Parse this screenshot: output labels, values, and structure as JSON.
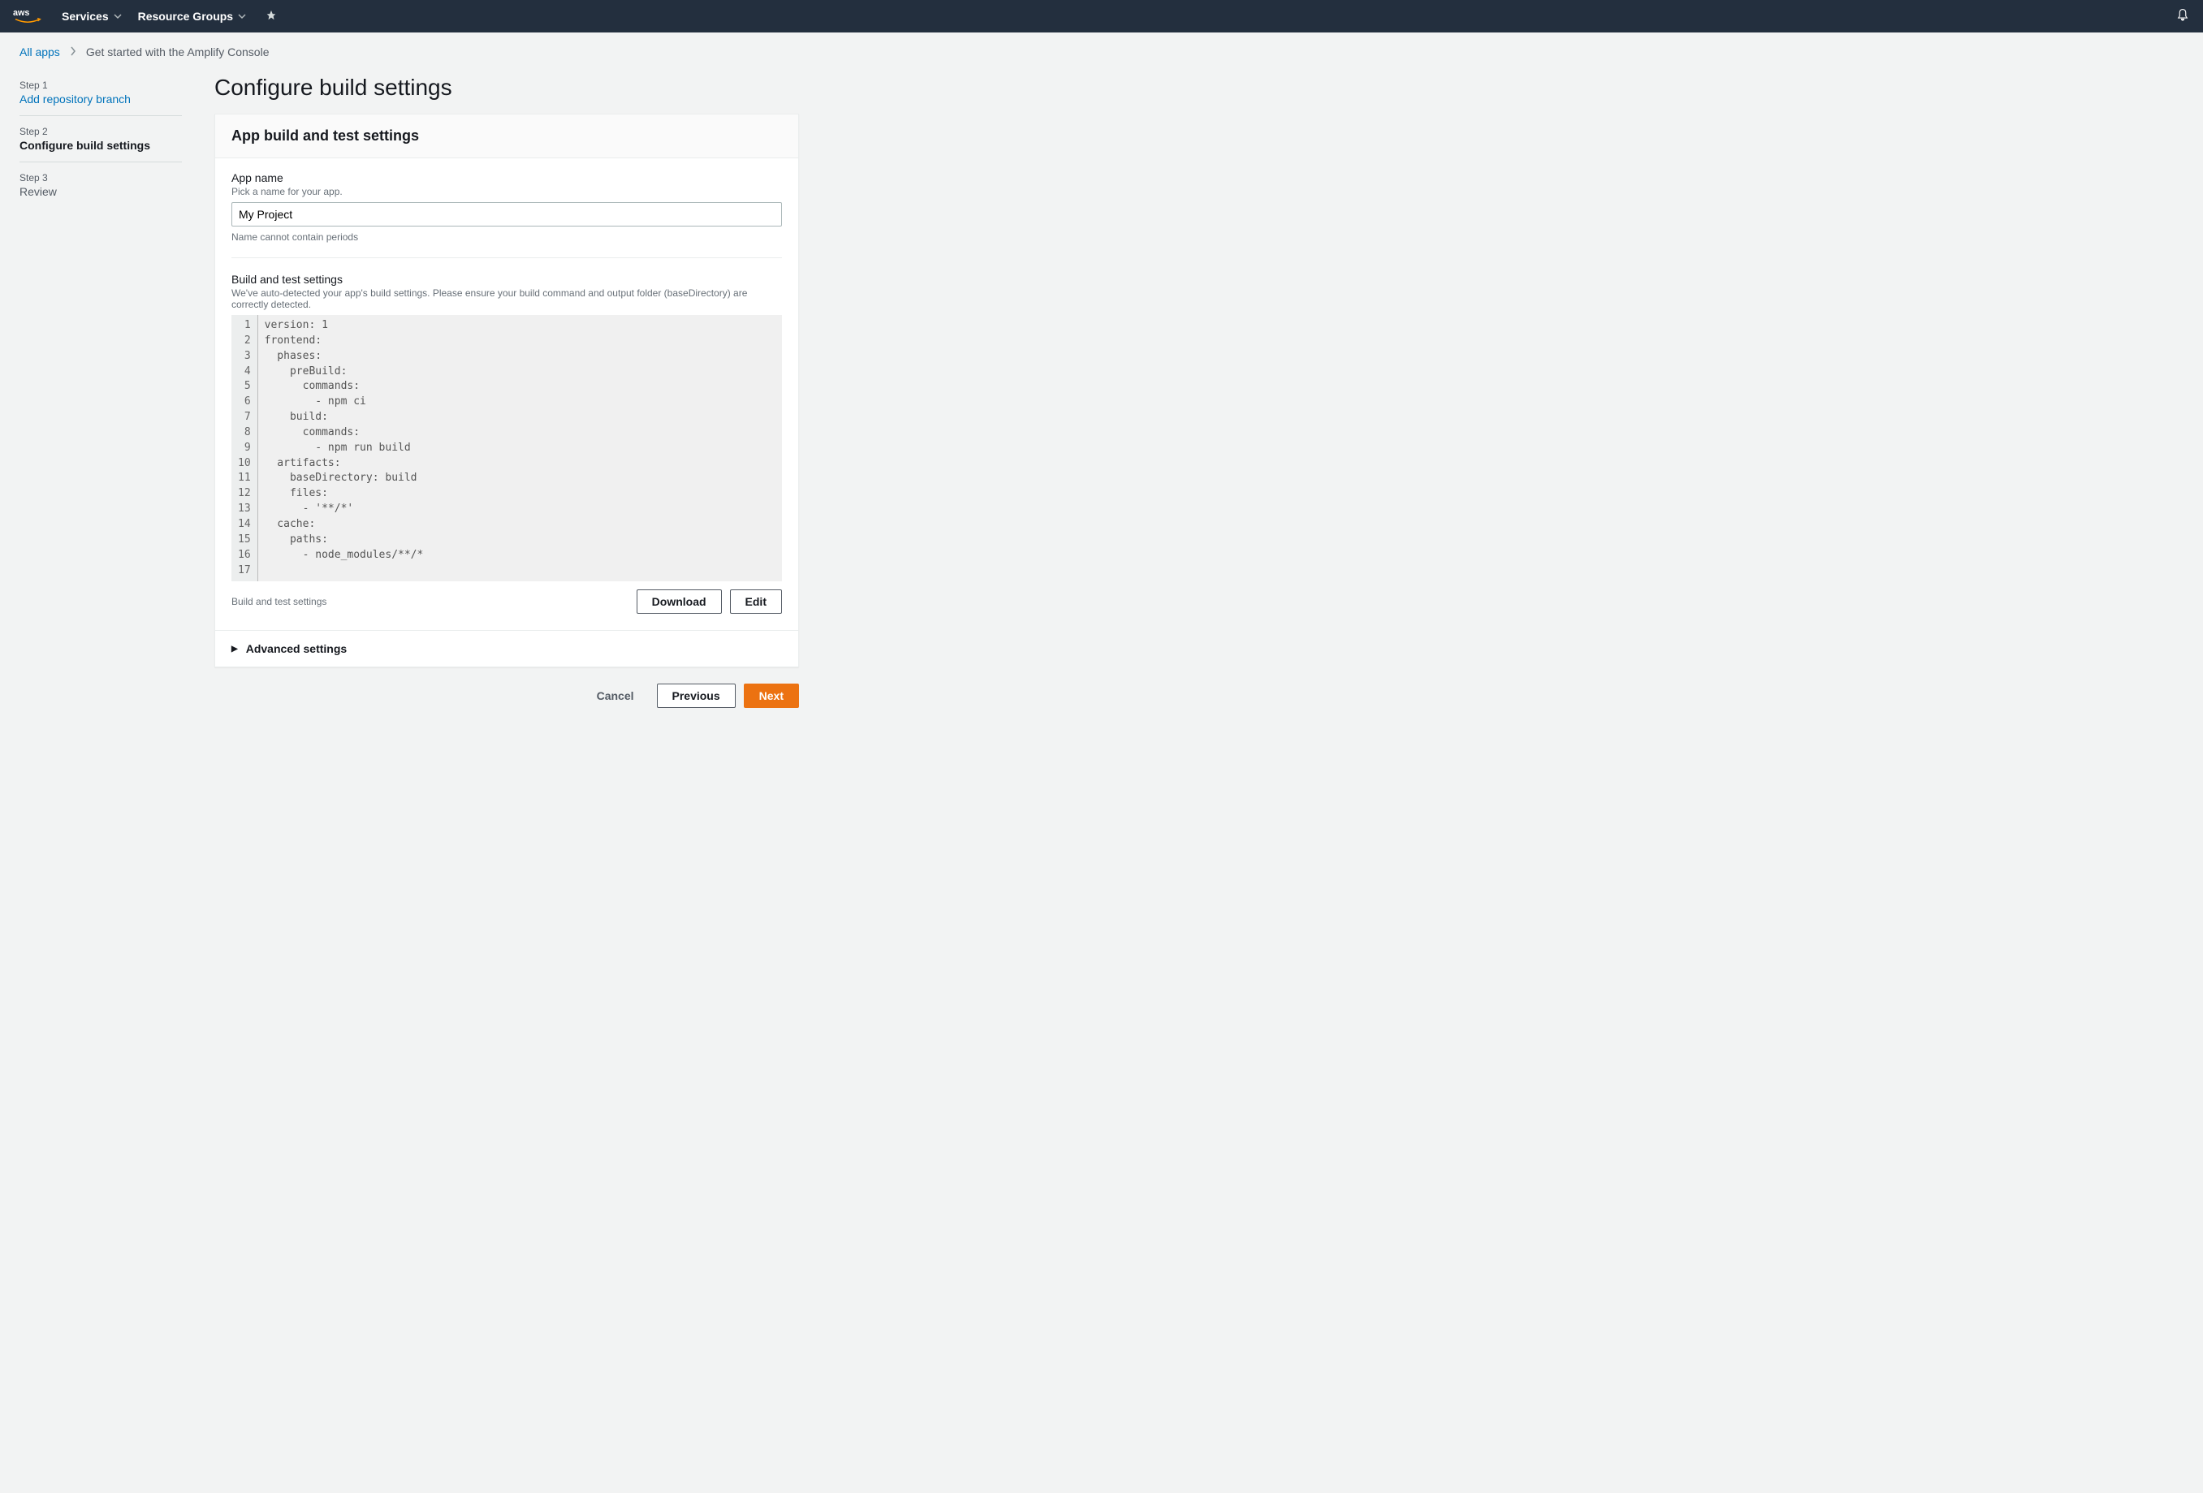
{
  "topnav": {
    "services_label": "Services",
    "resource_groups_label": "Resource Groups"
  },
  "breadcrumbs": {
    "all_apps": "All apps",
    "current": "Get started with the Amplify Console"
  },
  "sidebar": {
    "steps": [
      {
        "tag": "Step 1",
        "title": "Add repository branch"
      },
      {
        "tag": "Step 2",
        "title": "Configure build settings"
      },
      {
        "tag": "Step 3",
        "title": "Review"
      }
    ]
  },
  "main": {
    "title": "Configure build settings",
    "panel_title": "App build and test settings",
    "app_name": {
      "label": "App name",
      "hint": "Pick a name for your app.",
      "value": "My Project",
      "helper": "Name cannot contain periods"
    },
    "build_settings": {
      "label": "Build and test settings",
      "hint": "We've auto-detected your app's build settings. Please ensure your build command and output folder (baseDirectory) are correctly detected.",
      "yaml_lines": [
        "version: 1",
        "frontend:",
        "  phases:",
        "    preBuild:",
        "      commands:",
        "        - npm ci",
        "    build:",
        "      commands:",
        "        - npm run build",
        "  artifacts:",
        "    baseDirectory: build",
        "    files:",
        "      - '**/*'",
        "  cache:",
        "    paths:",
        "      - node_modules/**/*",
        ""
      ],
      "footer_label": "Build and test settings",
      "download_label": "Download",
      "edit_label": "Edit"
    },
    "advanced_label": "Advanced settings"
  },
  "wizard_nav": {
    "cancel_label": "Cancel",
    "previous_label": "Previous",
    "next_label": "Next"
  }
}
